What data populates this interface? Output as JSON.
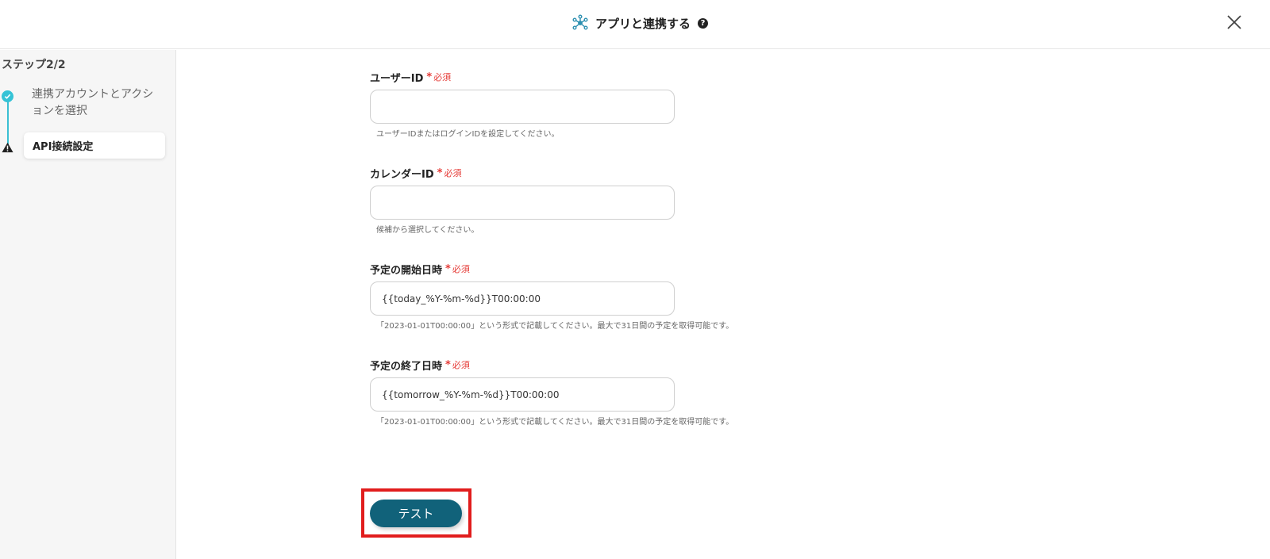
{
  "header": {
    "title": "アプリと連携する",
    "help_symbol": "?",
    "icon": "network-nodes-icon",
    "close_icon": "close-icon"
  },
  "sidebar": {
    "step_label": "ステップ2/2",
    "steps": [
      {
        "label": "連携アカウントとアクションを選択",
        "status": "completed",
        "icon": "check-circle-icon"
      },
      {
        "label": "API接続設定",
        "status": "current-warning",
        "icon": "warning-icon"
      }
    ]
  },
  "form": {
    "required_label": "必須",
    "required_mark": "*",
    "fields": [
      {
        "label": "ユーザーID",
        "value": "",
        "hint": "ユーザーIDまたはログインIDを設定してください。"
      },
      {
        "label": "カレンダーID",
        "value": "",
        "hint": "候補から選択してください。"
      },
      {
        "label": "予定の開始日時",
        "value": "{{today_%Y-%m-%d}}T00:00:00",
        "hint": "「2023-01-01T00:00:00」という形式で記載してください。最大で31日間の予定を取得可能です。"
      },
      {
        "label": "予定の終了日時",
        "value": "{{tomorrow_%Y-%m-%d}}T00:00:00",
        "hint": "「2023-01-01T00:00:00」という形式で記載してください。最大で31日間の予定を取得可能です。"
      }
    ]
  },
  "test_button": {
    "label": "テスト"
  },
  "colors": {
    "accent": "#11627a",
    "step_done": "#35c3d6",
    "required": "#e53935",
    "highlight": "#e11d1d"
  }
}
